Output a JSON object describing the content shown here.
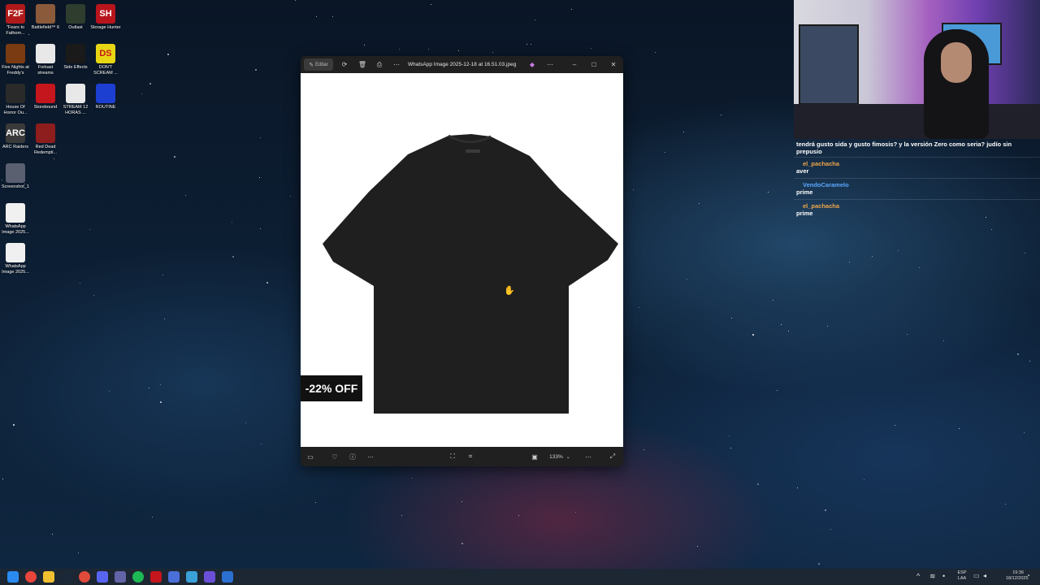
{
  "desktop": {
    "icons": [
      {
        "label": "\"Fears to Fathom...",
        "badge": "F2F",
        "color": "#b01919"
      },
      {
        "label": "Battlefield™ 6",
        "badge": "",
        "color": "#8a5a3a"
      },
      {
        "label": "Outlast",
        "badge": "",
        "color": "#2e3d2e"
      },
      {
        "label": "Storage Hunter",
        "badge": "SH",
        "color": "#b8141c"
      },
      {
        "label": "Five Nights at Freddy's",
        "badge": "",
        "color": "#7a3a12"
      },
      {
        "label": "Forkast streams",
        "badge": "",
        "color": "#e8e8e8"
      },
      {
        "label": "Side Effects",
        "badge": "",
        "color": "#1a1a1a"
      },
      {
        "label": "DON'T SCREAM ...",
        "badge": "DS",
        "color": "#e8d514"
      },
      {
        "label": "House Of Horror Ou...",
        "badge": "",
        "color": "#2a2a2a"
      },
      {
        "label": "Storebound",
        "badge": "",
        "color": "#c4161c"
      },
      {
        "label": "STREAM 12 HORAS ...",
        "badge": "",
        "color": "#e8e8e8"
      },
      {
        "label": "ROUTINE",
        "badge": "",
        "color": "#1c3fd1"
      },
      {
        "label": "ARC Raiders",
        "badge": "ARC",
        "color": "#3a3a3a"
      },
      {
        "label": "Red Dead Redempti...",
        "badge": "",
        "color": "#8e1d1d"
      },
      {
        "label": "Screenshot_1",
        "badge": "",
        "color": "#5a6070"
      },
      {
        "label": "WhatsApp Image 2025...",
        "badge": "",
        "color": "#f0f0f0"
      },
      {
        "label": "WhatsApp Image 2025...",
        "badge": "",
        "color": "#f0f0f0"
      }
    ]
  },
  "viewer": {
    "edit_label": "Editar",
    "file_title": "WhatsApp Image 2025-12-18 at 16.51.03.jpeg",
    "zoom": "133%",
    "sale_badge": "-22% OFF",
    "icons": {
      "rotate": "rotate-icon",
      "delete": "trash-icon",
      "print": "print-icon",
      "more": "more-icon",
      "minimize": "minimize-icon",
      "maximize": "maximize-icon",
      "close": "close-icon"
    }
  },
  "chat": {
    "top_message": "tendrá gusto sida y gusto fimosis? y la versión Zero como seria? judío sin prepusio",
    "messages": [
      {
        "user": "el_pachacha",
        "user_color": "#f0a64a",
        "text": "aver"
      },
      {
        "user": "VendoCaramelo",
        "user_color": "#5aa7ff",
        "text": "prime"
      },
      {
        "user": "el_pachacha",
        "user_color": "#f0a64a",
        "text": "prime"
      }
    ]
  },
  "taskbar": {
    "lang_top": "ESP",
    "lang_bottom": "LAA",
    "time": "19:36",
    "date": "18/12/2025"
  }
}
